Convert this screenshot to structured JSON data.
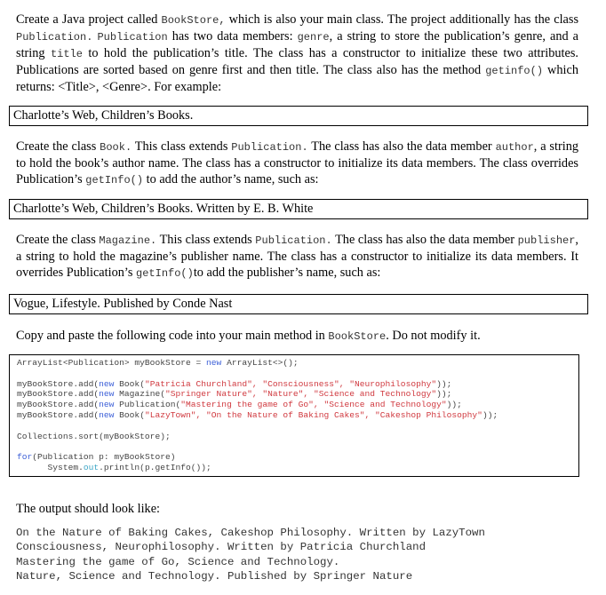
{
  "paragraph1": {
    "t1": "Create a Java project called ",
    "c1": "BookStore,",
    "t2": " which is also your main class. The project additionally has the class ",
    "c2": "Publication.",
    "t3": " ",
    "c3": "Publication",
    "t4": " has two data members: ",
    "c4": "genre",
    "t5": ", a string to store the publication’s genre, and a string ",
    "c5": "title",
    "t6": " to hold the publication’s title. The class has a constructor to initialize these two attributes. Publications are sorted based on genre first and then title. The class also has the method ",
    "c6": "getinfo()",
    "t7": " which returns: <Title>, <Genre>. For example:"
  },
  "example1": "Charlotte’s Web, Children’s Books.",
  "paragraph2": {
    "t1": "Create the class ",
    "c1": "Book.",
    "t2": " This class extends ",
    "c2": "Publication.",
    "t3": "  The class has also the data member ",
    "c3": "author",
    "t4": ", a string to hold the book’s author name.  The class has a constructor to initialize its data members. The class overrides Publication’s ",
    "c4": "getInfo()",
    "t5": " to add the author’s name, such as:"
  },
  "example2": "Charlotte’s Web, Children’s Books. Written by E. B. White",
  "paragraph3": {
    "t1": "Create the class ",
    "c1": "Magazine.",
    "t2": " This class extends ",
    "c2": "Publication.",
    "t3": "  The class has also the data member ",
    "c3": "publisher",
    "t4": ", a string to hold the magazine’s publisher name. The class has a constructor to initialize its data members. It overrides Publication’s ",
    "c4": "getInfo()",
    "t5": "to add the publisher’s name, such as:"
  },
  "example3": "Vogue, Lifestyle. Published by Conde Nast",
  "paragraph4": {
    "t1": "Copy and paste the following code into your main method in ",
    "c1": "BookStore",
    "t2": ". Do not modify it."
  },
  "code": {
    "line1": {
      "a": "ArrayList<Publication> myBookStore = ",
      "kw": "new",
      "b": " ArrayList<>();"
    },
    "adds": [
      {
        "a": "myBookStore.add(",
        "kw": "new",
        "b": " Book(",
        "s": "\"Patricia Churchland\", \"Consciousness\", \"Neurophilosophy\"",
        "c": "));"
      },
      {
        "a": "myBookStore.add(",
        "kw": "new",
        "b": " Magazine(",
        "s": "\"Springer Nature\", \"Nature\", \"Science and Technology\"",
        "c": "));"
      },
      {
        "a": "myBookStore.add(",
        "kw": "new",
        "b": " Publication(",
        "s": "\"Mastering the game of Go\", \"Science and Technology\"",
        "c": "));"
      },
      {
        "a": "myBookStore.add(",
        "kw": "new",
        "b": " Book(",
        "s": "\"LazyTown\", \"On the Nature of Baking Cakes\", \"Cakeshop Philosophy\"",
        "c": "));"
      }
    ],
    "sort": "Collections.sort(myBookStore);",
    "for_kw": "for",
    "for_rest": "(Publication p: myBookStore)",
    "print_a": "      System.",
    "print_fld": "out",
    "print_b": ".println(p.getInfo());"
  },
  "paragraph5": "The output should look like:",
  "output": [
    "On the Nature of Baking Cakes, Cakeshop Philosophy. Written by LazyTown",
    "Consciousness, Neurophilosophy. Written by Patricia Churchland",
    "Mastering the game of Go, Science and Technology.",
    "Nature, Science and Technology. Published by Springer Nature"
  ]
}
